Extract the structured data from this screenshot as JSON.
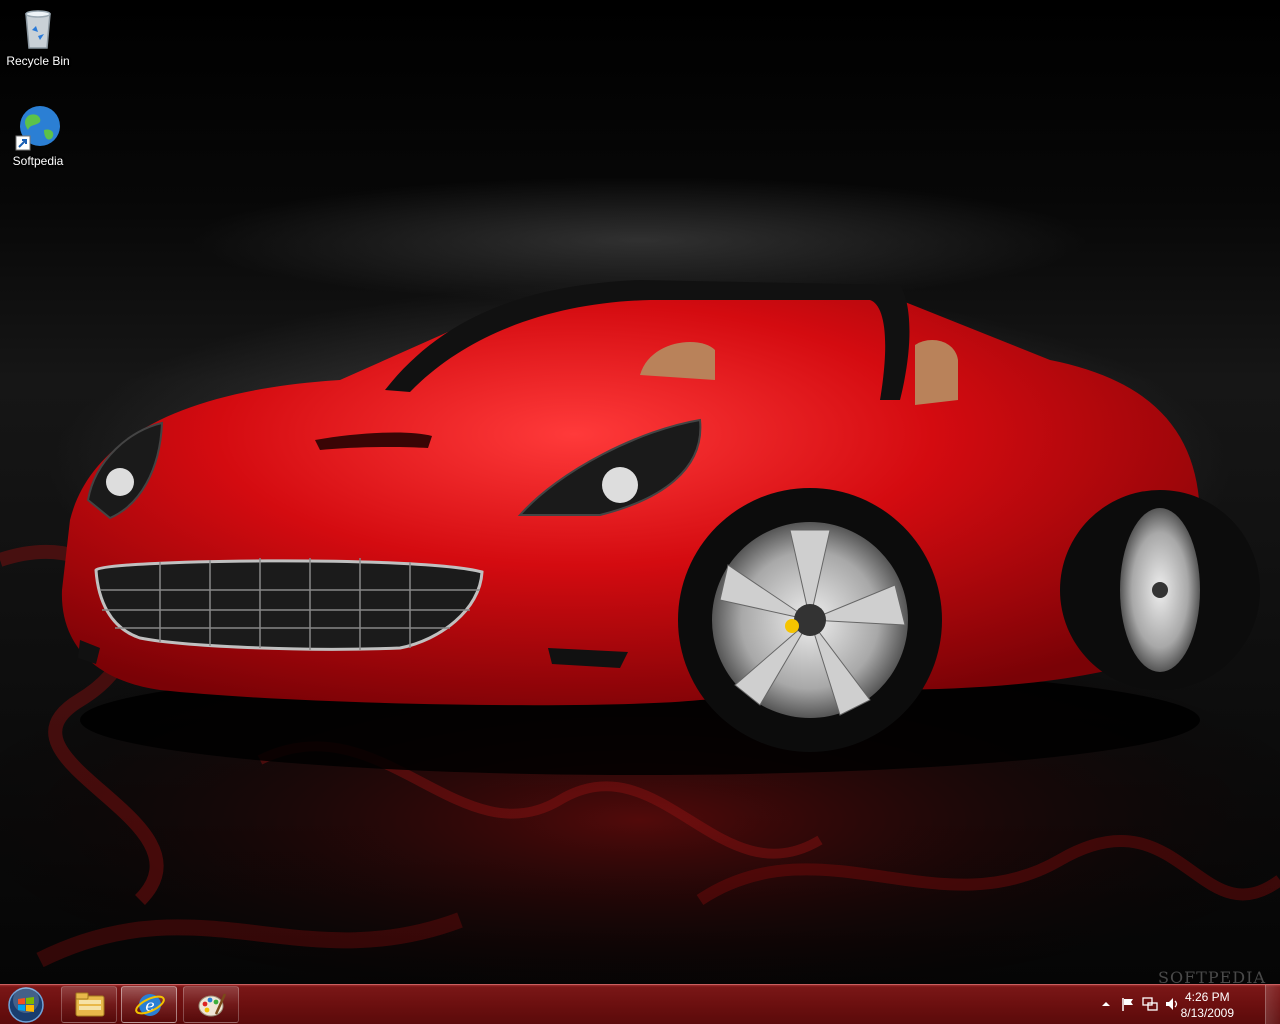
{
  "desktop": {
    "icons": [
      {
        "label": "Recycle Bin",
        "icon": "recycle-bin-icon"
      },
      {
        "label": "Softpedia",
        "icon": "globe-shortcut-icon"
      }
    ],
    "wallpaper": "red-convertible-sports-car"
  },
  "taskbar": {
    "start": {
      "icon": "windows-orb-icon"
    },
    "pinned": [
      {
        "icon": "windows-explorer-icon"
      },
      {
        "icon": "internet-explorer-icon"
      },
      {
        "icon": "paint-icon"
      }
    ],
    "tray": {
      "icons": [
        "show-hidden-icons-arrow-icon",
        "action-center-flag-icon",
        "network-icon",
        "volume-icon"
      ],
      "time": "4:26 PM",
      "date": "8/13/2009"
    }
  },
  "watermark": "SOFTPEDIA",
  "colors": {
    "taskbar": "#6d1010",
    "car": "#d40b10",
    "background": "#000000"
  }
}
